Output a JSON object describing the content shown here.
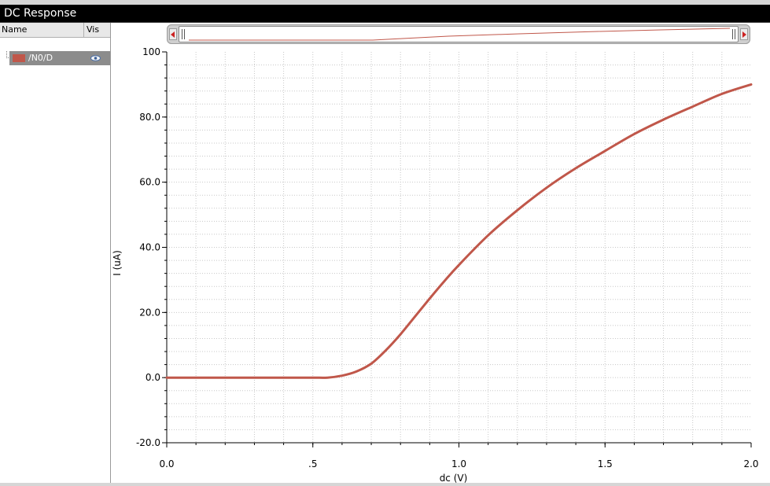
{
  "window": {
    "title": "DC Response"
  },
  "sidebar": {
    "columns": {
      "name": "Name",
      "vis": "Vis"
    },
    "traces": [
      {
        "label": "/N0/D",
        "color": "#c0574a",
        "visible_icon": "eye-icon"
      }
    ]
  },
  "colors": {
    "trace": "#c0574a",
    "titlebar": "#000000",
    "grid": "#c8c8c8"
  },
  "chart_data": {
    "type": "line",
    "title": "",
    "xlabel": "dc (V)",
    "ylabel": "I (uA)",
    "xlim": [
      0.0,
      2.0
    ],
    "ylim": [
      -20.0,
      100.0
    ],
    "xticks": [
      "0.0",
      ".5",
      "1.0",
      "1.5",
      "2.0"
    ],
    "yticks": [
      "-20.0",
      "0.0",
      "20.0",
      "40.0",
      "60.0",
      "80.0",
      "100"
    ],
    "grid": true,
    "legend": "sidebar",
    "series": [
      {
        "name": "/N0/D",
        "color": "#c0574a",
        "x": [
          0.0,
          0.1,
          0.2,
          0.3,
          0.4,
          0.5,
          0.55,
          0.6,
          0.65,
          0.7,
          0.75,
          0.8,
          0.85,
          0.9,
          0.95,
          1.0,
          1.1,
          1.2,
          1.3,
          1.4,
          1.5,
          1.6,
          1.7,
          1.8,
          1.9,
          2.0
        ],
        "y": [
          0.0,
          0.0,
          0.0,
          0.0,
          0.0,
          0.0,
          0.0,
          0.6,
          1.9,
          4.3,
          8.4,
          13.3,
          18.8,
          24.3,
          29.6,
          34.6,
          43.7,
          51.4,
          58.3,
          64.3,
          69.6,
          74.8,
          79.2,
          83.2,
          87.1,
          90.0
        ]
      }
    ]
  }
}
